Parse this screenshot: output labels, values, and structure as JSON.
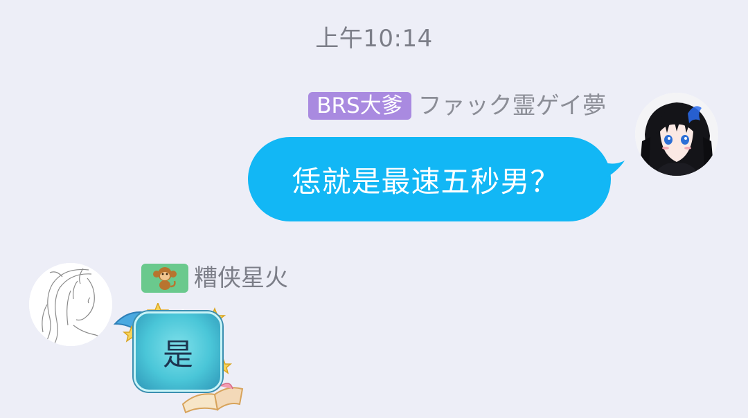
{
  "chat": {
    "timestamp": "上午10:14",
    "sent": {
      "title_badge": "BRS大爹",
      "sender_name": "ファック霊ゲイ夢",
      "text": "恁就是最速五秒男？",
      "bubble_color": "#12b7f5"
    },
    "received": {
      "badge_icon": "monkey-icon",
      "sender_name": "糟侠星火",
      "text": "是",
      "bubble_style": "star-decorated-teal-bubble"
    }
  },
  "colors": {
    "background": "#edeef7",
    "title_badge": "#a98ae0",
    "recv_badge": "#6ac98d"
  }
}
